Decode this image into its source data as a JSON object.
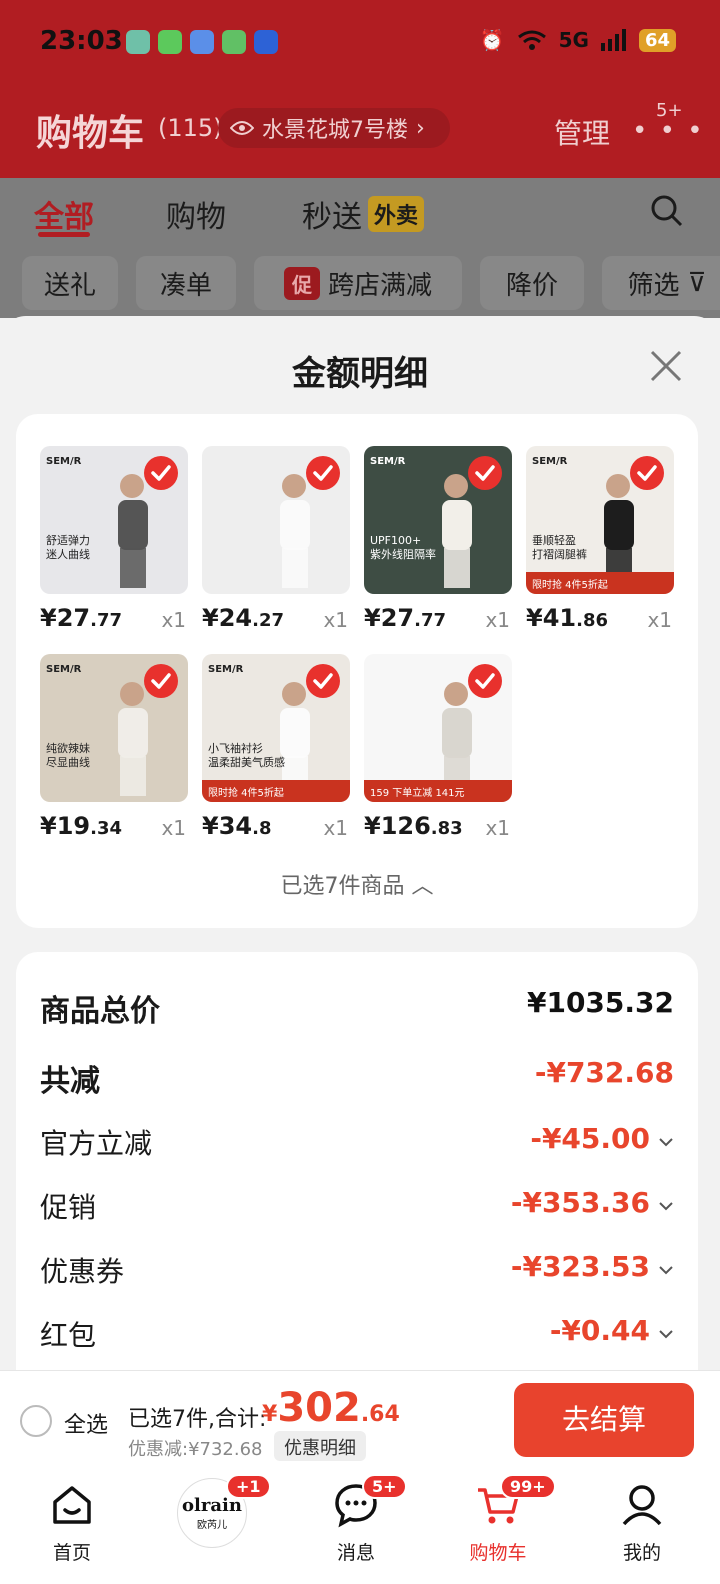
{
  "status_bar": {
    "time": "23:03",
    "network": "5G",
    "battery": "64",
    "app_icons": [
      "maps-icon",
      "wechat-icon",
      "cloud-icon",
      "message-icon",
      "qq-icon"
    ]
  },
  "header": {
    "title": "购物车",
    "count": "(115)",
    "location": "水景花城7号楼",
    "manage": "管理",
    "more_badge": "5+"
  },
  "tabs": [
    {
      "label": "全部",
      "active": true
    },
    {
      "label": "购物",
      "active": false
    },
    {
      "label": "秒送",
      "active": false,
      "badge": "外卖"
    }
  ],
  "filters": [
    {
      "label": "送礼"
    },
    {
      "label": "凑单"
    },
    {
      "label": "跨店满减",
      "tag": "促"
    },
    {
      "label": "降价"
    },
    {
      "label": "筛选"
    }
  ],
  "sheet": {
    "title": "金额明细",
    "selected_summary": "已选7件商品"
  },
  "goods": [
    {
      "brand": "SEM/R",
      "caption": "舒适弹力\n迷人曲线",
      "price_int": "¥27",
      "price_dec": ".77",
      "qty": "x1",
      "bg": "#e7e7ea",
      "fig": "#555555"
    },
    {
      "brand": "",
      "caption": "",
      "price_int": "¥24",
      "price_dec": ".27",
      "qty": "x1",
      "bg": "#eeeeee",
      "fig": "#fafafa"
    },
    {
      "brand": "SEM/R",
      "caption": "UPF100+\n紫外线阻隔率",
      "price_int": "¥27",
      "price_dec": ".77",
      "qty": "x1",
      "bg": "#3e4d44",
      "fig": "#f2efe9",
      "light": true
    },
    {
      "brand": "SEM/R",
      "caption": "垂顺轻盈\n打褶阔腿裤",
      "price_int": "¥41",
      "price_dec": ".86",
      "qty": "x1",
      "bg": "#f0ede8",
      "fig": "#1d1d1d",
      "strip": "限时抢 4件5折起"
    },
    {
      "brand": "SEM/R",
      "caption": "纯欲辣妹\n尽显曲线",
      "price_int": "¥19",
      "price_dec": ".34",
      "qty": "x1",
      "bg": "#d8cfc0",
      "fig": "#f0ede8"
    },
    {
      "brand": "SEM/R",
      "caption": "小飞袖衬衫\n温柔甜美气质感",
      "price_int": "¥34",
      "price_dec": ".8",
      "qty": "x1",
      "bg": "#ece8e2",
      "fig": "#fbfbfb",
      "strip": "限时抢 4件5折起"
    },
    {
      "brand": "",
      "caption": "",
      "price_int": "¥126",
      "price_dec": ".83",
      "qty": "x1",
      "bg": "#f7f7f7",
      "fig": "#d9d6cf",
      "strip": "159  下单立减 141元"
    }
  ],
  "amounts": {
    "goods_total": {
      "label": "商品总价",
      "value": "¥1035.32"
    },
    "total_reduced": {
      "label": "共减",
      "value": "-¥732.68"
    },
    "lines": [
      {
        "label": "官方立减",
        "value": "-¥45.00"
      },
      {
        "label": "促销",
        "value": "-¥353.36"
      },
      {
        "label": "优惠券",
        "value": "-¥323.53"
      },
      {
        "label": "红包",
        "value": "-¥0.44"
      }
    ]
  },
  "checkout": {
    "select_all": "全选",
    "selected_text": "已选7件,合计:",
    "currency": "¥",
    "total_int": "302",
    "total_dec": ".64",
    "discount_text": "优惠减:¥732.68",
    "detail_button": "优惠明细",
    "checkout_button": "去结算"
  },
  "tabbar": [
    {
      "label": "首页",
      "icon": "home-icon"
    },
    {
      "label": "欧芮儿",
      "icon": "olrain-logo",
      "logo_text": "olrain",
      "badge": "+1"
    },
    {
      "label": "消息",
      "icon": "message-bubble-icon",
      "badge": "5+"
    },
    {
      "label": "购物车",
      "icon": "cart-icon",
      "badge": "99+",
      "active": true
    },
    {
      "label": "我的",
      "icon": "profile-icon"
    }
  ],
  "colors": {
    "brand_red": "#e8312d",
    "header_red": "#b11d22",
    "price_red": "#e8452c"
  }
}
